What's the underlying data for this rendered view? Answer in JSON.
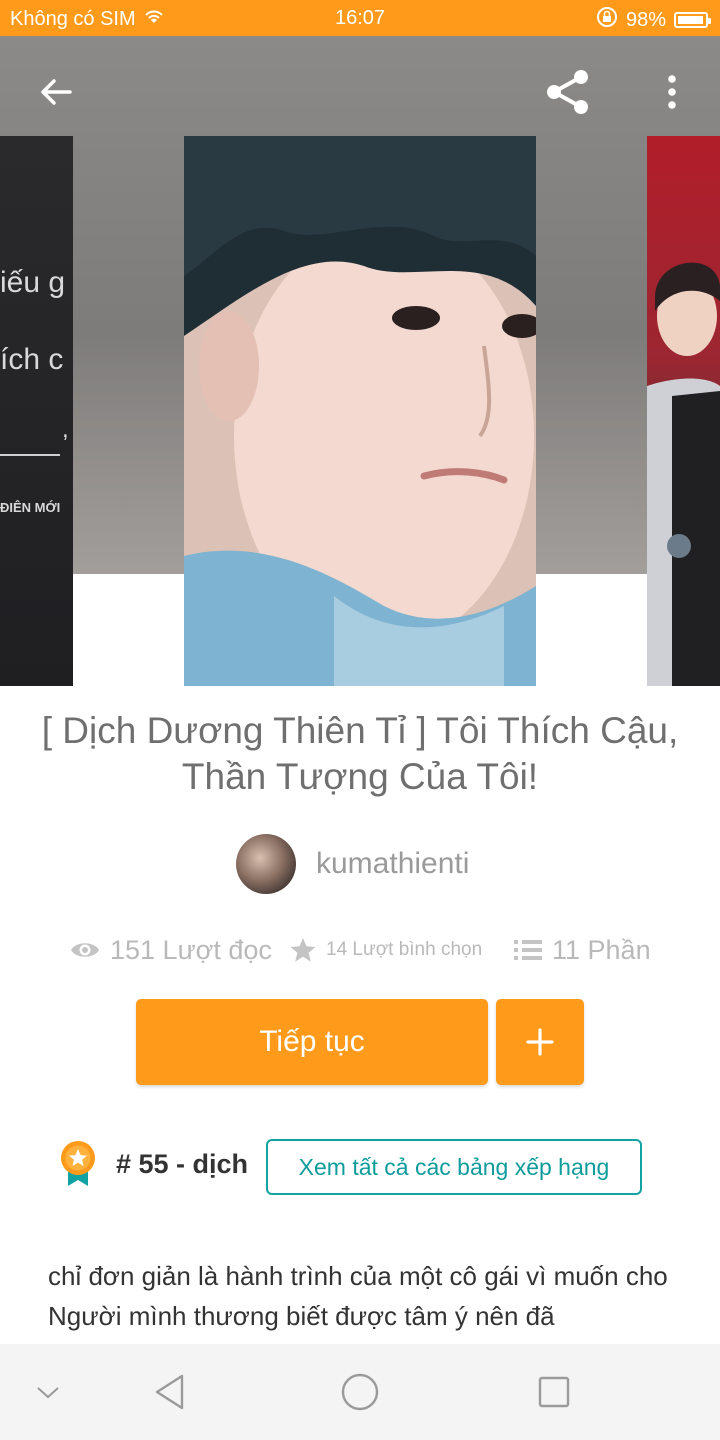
{
  "status_bar": {
    "carrier": "Không có SIM",
    "time": "16:07",
    "battery": "98%",
    "battery_level": 0.98
  },
  "cover_left": {
    "line1": "iếu g",
    "line2": "ích c",
    "mark": ",",
    "footer": "ĐIÊN MỚI"
  },
  "story": {
    "title": "[ Dịch Dương Thiên Tỉ ] Tôi Thích Cậu, Thần Tượng Của Tôi!",
    "author": "kumathienti",
    "reads": "151 Lượt đọc",
    "votes": "14 Lượt bình chọn",
    "parts": "11 Phần",
    "description": "chỉ đơn giản là hành trình của một cô gái vì muốn cho Người mình thương biết được tâm ý nên đã"
  },
  "actions": {
    "continue_label": "Tiếp tục",
    "add_label": "+"
  },
  "ranking": {
    "rank_text": "# 55 - dịch",
    "view_all_label": "Xem tất cả các bảng xếp hạng"
  },
  "colors": {
    "accent": "#ff9a1a",
    "teal": "#14a3a3"
  }
}
